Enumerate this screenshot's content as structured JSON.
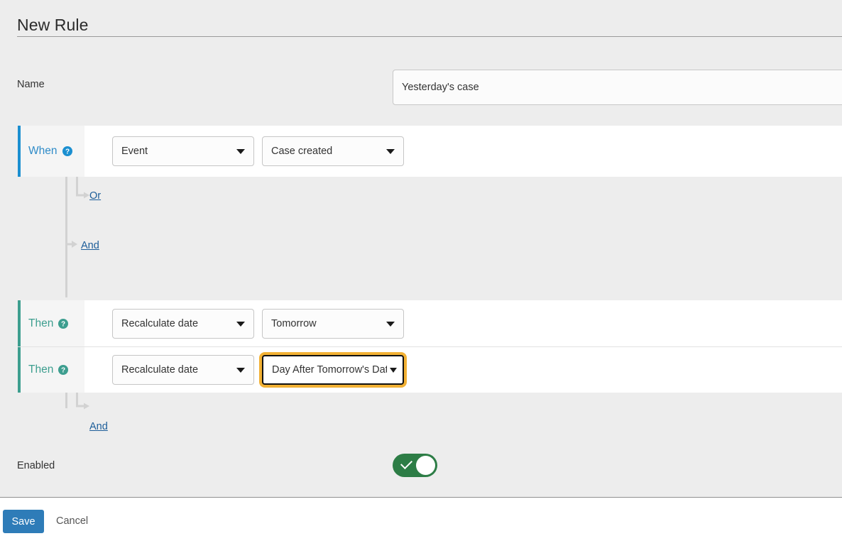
{
  "header": {
    "title": "New Rule"
  },
  "name_field": {
    "label": "Name",
    "value": "Yesterday's case",
    "placeholder": ""
  },
  "rule": {
    "when": {
      "label": "When",
      "help_icon": "help-circle-icon",
      "accent_color": "#1b8fd0",
      "selects": [
        {
          "name": "trigger-type-select",
          "value": "Event",
          "icon": "chevron-down-icon"
        },
        {
          "name": "trigger-event-select",
          "value": "Case created",
          "icon": "chevron-down-icon"
        }
      ]
    },
    "branch_links": [
      {
        "name": "or-link",
        "label": "Or"
      },
      {
        "name": "and-link",
        "label": "And"
      }
    ],
    "then_rows": [
      {
        "label": "Then",
        "help_icon": "help-circle-icon",
        "accent_color": "#3d9e8f",
        "selects": [
          {
            "name": "action-type-select",
            "value": "Recalculate date",
            "icon": "chevron-down-icon",
            "focused": false
          },
          {
            "name": "action-value-select",
            "value": "Tomorrow",
            "icon": "chevron-down-icon",
            "focused": false
          }
        ]
      },
      {
        "label": "Then",
        "help_icon": "help-circle-icon",
        "accent_color": "#3d9e8f",
        "selects": [
          {
            "name": "action-type-select",
            "value": "Recalculate date",
            "icon": "chevron-down-icon",
            "focused": false
          },
          {
            "name": "action-value-select",
            "value": "Day After Tomorrow's Date",
            "icon": "chevron-down-icon",
            "focused": true
          }
        ]
      }
    ],
    "bottom_and_link": {
      "name": "and-link",
      "label": "And"
    }
  },
  "enabled_field": {
    "label": "Enabled",
    "state": "on",
    "toggle_color": "#2d7d46"
  },
  "footer": {
    "save_label": "Save",
    "cancel_label": "Cancel",
    "save_color": "#2e7cb8"
  }
}
